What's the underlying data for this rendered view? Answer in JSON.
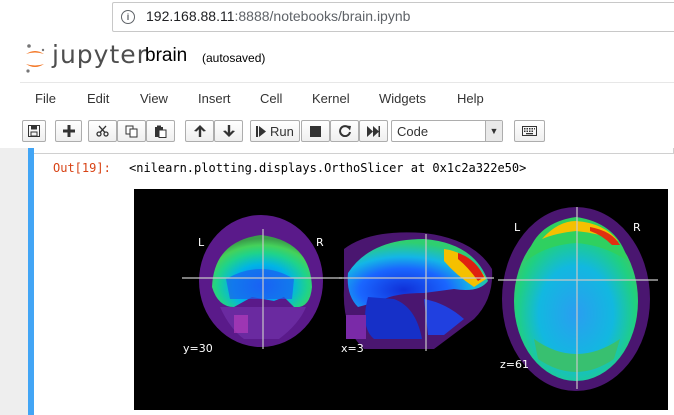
{
  "browser": {
    "url_host": "192.168.88.11",
    "url_rest": ":8888/notebooks/brain.ipynb",
    "info_icon": "info-icon"
  },
  "header": {
    "logo_text": "jupyter",
    "notebook_name": "brain",
    "save_status": "(autosaved)"
  },
  "menu": {
    "items": [
      "File",
      "Edit",
      "View",
      "Insert",
      "Cell",
      "Kernel",
      "Widgets",
      "Help"
    ]
  },
  "toolbar": {
    "run_label": "Run",
    "cell_type": "Code",
    "icons": [
      "save-icon",
      "plus-icon",
      "scissors-icon",
      "copy-icon",
      "paste-icon",
      "arrow-up-icon",
      "arrow-down-icon",
      "play-icon",
      "stop-icon",
      "restart-icon",
      "fast-forward-icon",
      "keyboard-icon"
    ]
  },
  "output": {
    "prompt": "Out[19]:",
    "text": "<nilearn.plotting.displays.OrthoSlicer at 0x1c2a322e50>"
  },
  "figure": {
    "left_label_1": "L",
    "right_label_1": "R",
    "left_label_3": "L",
    "right_label_3": "R",
    "coronal_coord": "y=30",
    "sagittal_coord": "x=3",
    "axial_coord": "z=61"
  }
}
